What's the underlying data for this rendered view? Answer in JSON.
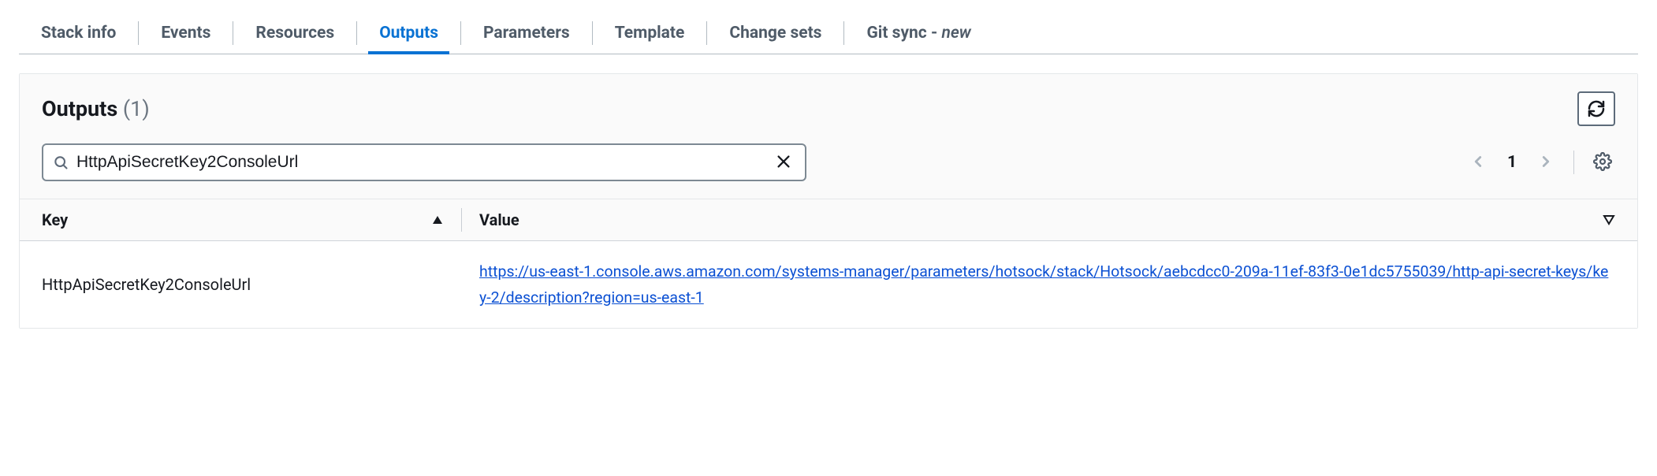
{
  "tabs": [
    {
      "label": "Stack info"
    },
    {
      "label": "Events"
    },
    {
      "label": "Resources"
    },
    {
      "label": "Outputs",
      "active": true
    },
    {
      "label": "Parameters"
    },
    {
      "label": "Template"
    },
    {
      "label": "Change sets"
    },
    {
      "label": "Git sync",
      "suffix": "new"
    }
  ],
  "panel": {
    "title": "Outputs",
    "count": "(1)"
  },
  "search": {
    "value": "HttpApiSecretKey2ConsoleUrl"
  },
  "pagination": {
    "current": "1"
  },
  "table": {
    "columns": {
      "key": "Key",
      "value": "Value"
    },
    "rows": [
      {
        "key": "HttpApiSecretKey2ConsoleUrl",
        "value": "https://us-east-1.console.aws.amazon.com/systems-manager/parameters/hotsock/stack/Hotsock/aebcdcc0-209a-11ef-83f3-0e1dc5755039/http-api-secret-keys/key-2/description?region=us-east-1"
      }
    ]
  }
}
